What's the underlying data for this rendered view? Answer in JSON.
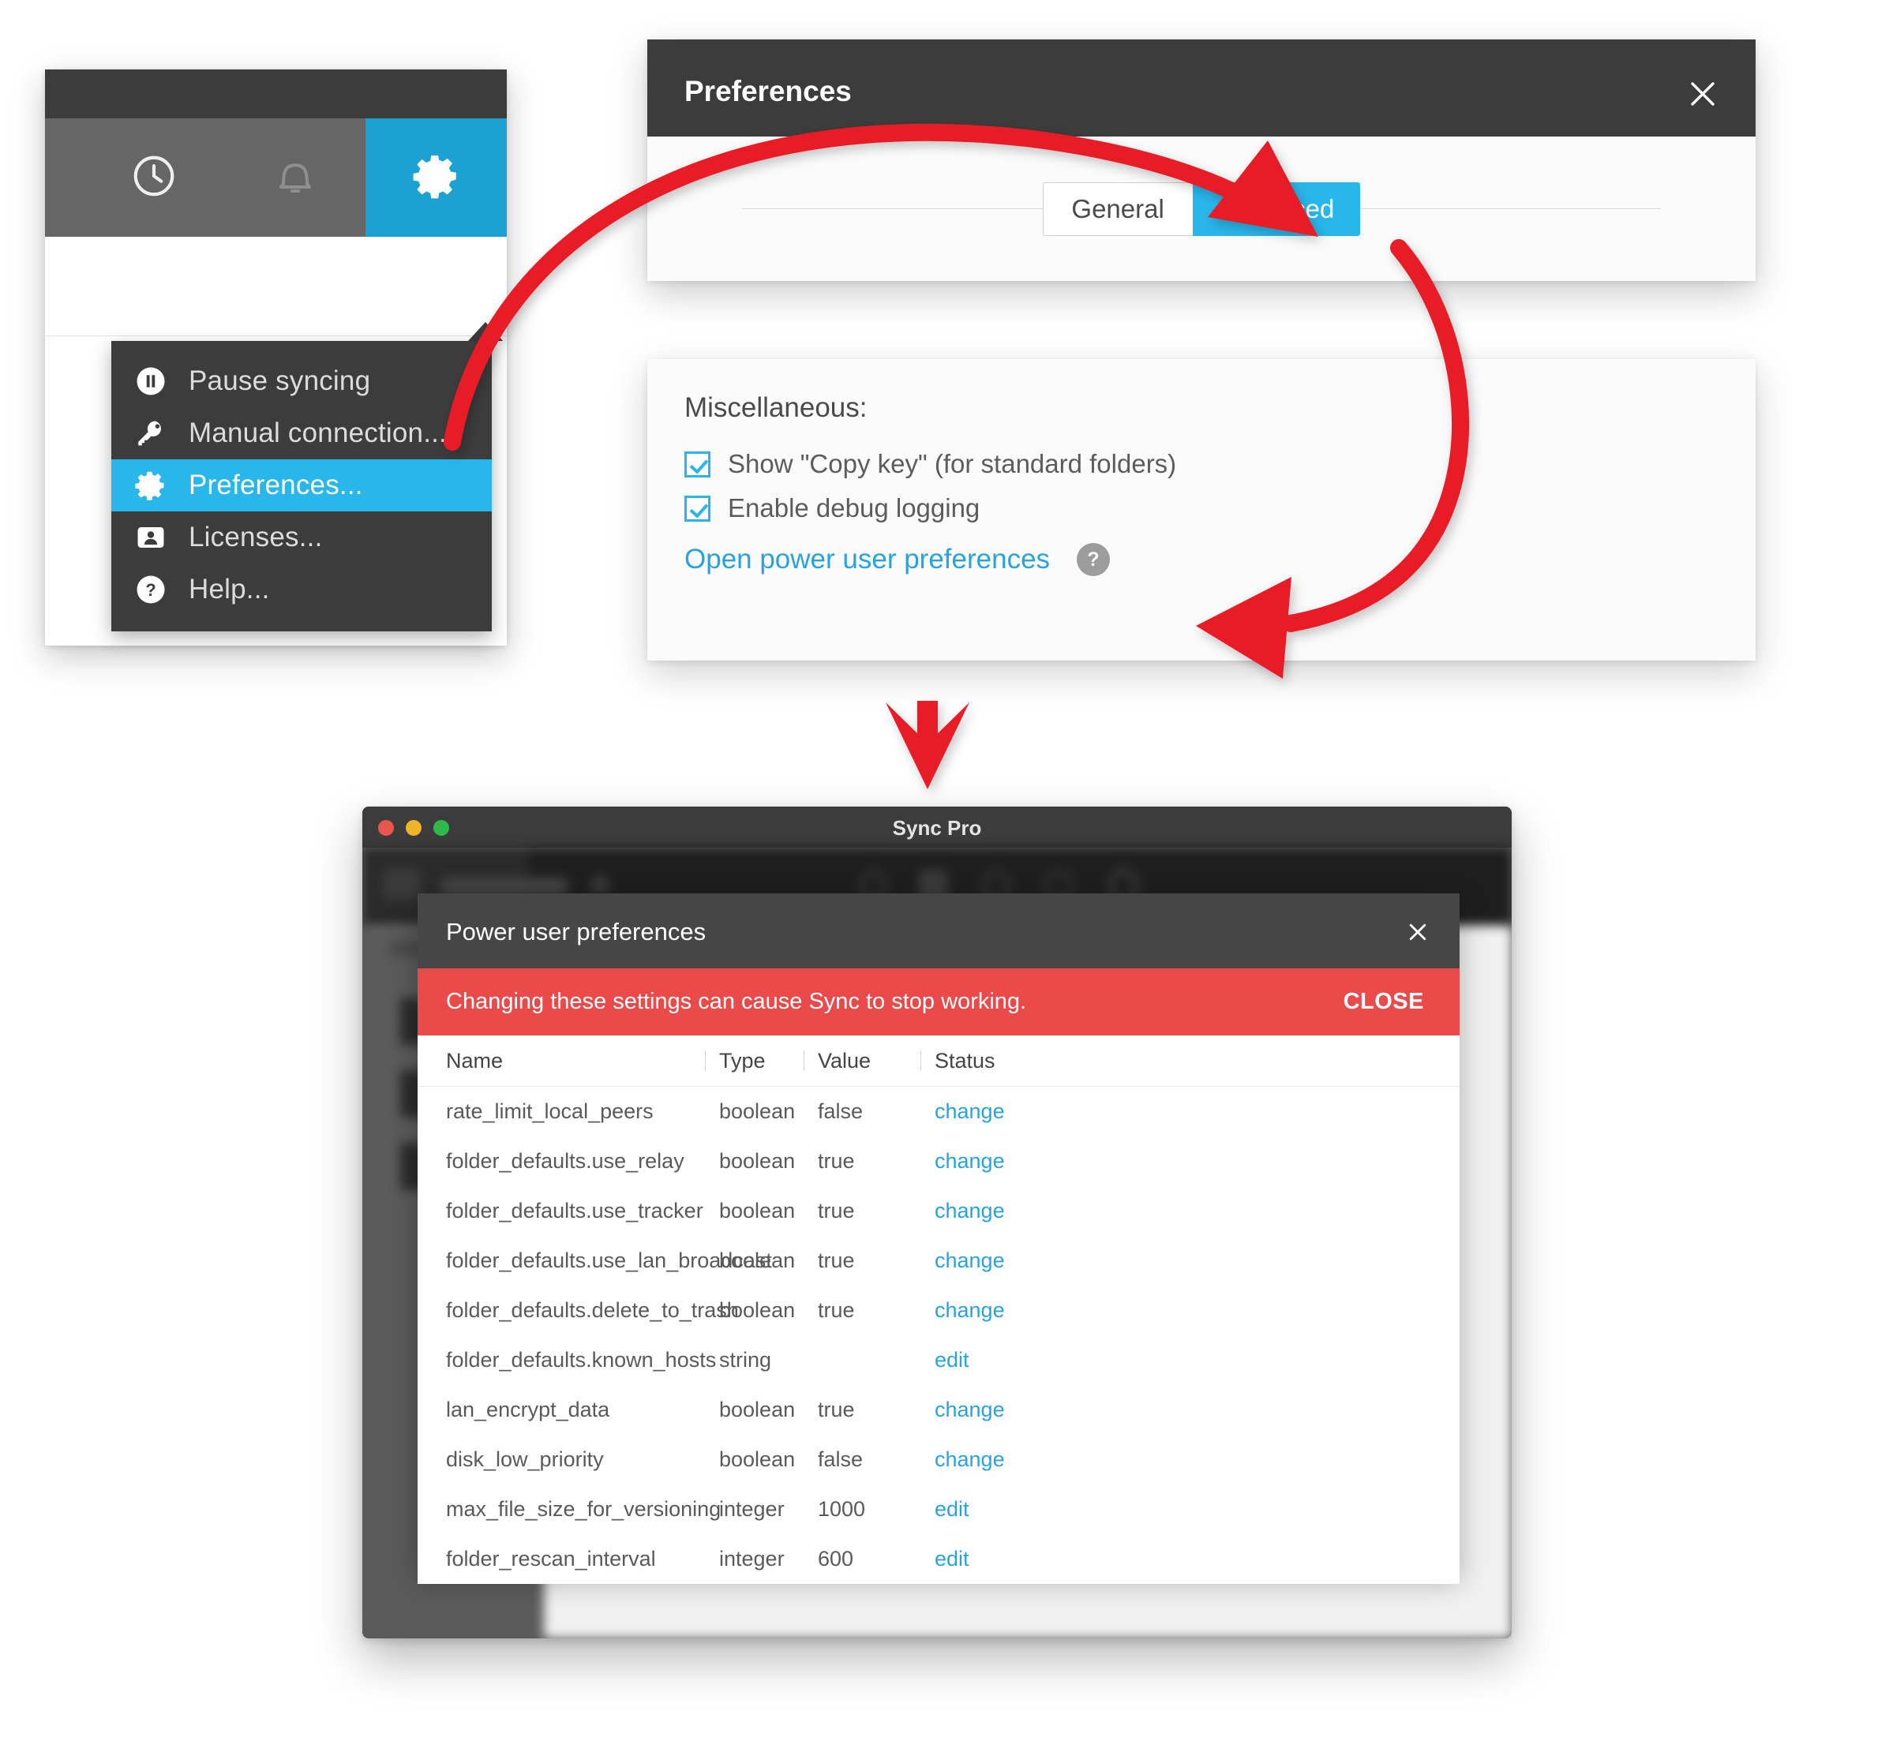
{
  "tray": {
    "toolbar_icons": [
      {
        "name": "history-icon",
        "glyph": "clock"
      },
      {
        "name": "notifications-icon",
        "glyph": "bell"
      },
      {
        "name": "settings-icon",
        "glyph": "gear"
      }
    ],
    "menu": {
      "items": [
        {
          "icon": "pause-icon",
          "label": "Pause syncing",
          "selected": false
        },
        {
          "icon": "key-icon",
          "label": "Manual connection...",
          "selected": false
        },
        {
          "icon": "gear-icon",
          "label": "Preferences...",
          "selected": true
        },
        {
          "icon": "license-icon",
          "label": "Licenses...",
          "selected": false
        },
        {
          "icon": "help-icon",
          "label": "Help...",
          "selected": false
        }
      ]
    }
  },
  "preferences": {
    "title": "Preferences",
    "close_glyph": "✕",
    "tabs": [
      {
        "label": "General",
        "active": false
      },
      {
        "label": "Advanced",
        "active": true
      }
    ]
  },
  "misc": {
    "heading": "Miscellaneous:",
    "checkboxes": [
      {
        "label": "Show \"Copy key\" (for standard folders)",
        "checked": true
      },
      {
        "label": "Enable debug logging",
        "checked": true
      }
    ],
    "link": "Open power user preferences",
    "help_glyph": "?"
  },
  "syncpro": {
    "window_title": "Sync Pro",
    "traffic_lights": [
      "close",
      "minimize",
      "zoom"
    ],
    "background_toolbar_label": "Add Folder"
  },
  "power_user": {
    "title": "Power user preferences",
    "close_glyph": "✕",
    "warning_text": "Changing these settings can cause Sync to stop working.",
    "warning_close_label": "CLOSE",
    "columns": [
      "Name",
      "Type",
      "Value",
      "Status"
    ],
    "rows": [
      {
        "name": "rate_limit_local_peers",
        "type": "boolean",
        "value": "false",
        "status": "change"
      },
      {
        "name": "folder_defaults.use_relay",
        "type": "boolean",
        "value": "true",
        "status": "change"
      },
      {
        "name": "folder_defaults.use_tracker",
        "type": "boolean",
        "value": "true",
        "status": "change"
      },
      {
        "name": "folder_defaults.use_lan_broadcast",
        "type": "boolean",
        "value": "true",
        "status": "change"
      },
      {
        "name": "folder_defaults.delete_to_trash",
        "type": "boolean",
        "value": "true",
        "status": "change"
      },
      {
        "name": "folder_defaults.known_hosts",
        "type": "string",
        "value": "",
        "status": "edit"
      },
      {
        "name": "lan_encrypt_data",
        "type": "boolean",
        "value": "true",
        "status": "change"
      },
      {
        "name": "disk_low_priority",
        "type": "boolean",
        "value": "false",
        "status": "change"
      },
      {
        "name": "max_file_size_for_versioning",
        "type": "integer",
        "value": "1000",
        "status": "edit"
      },
      {
        "name": "folder_rescan_interval",
        "type": "integer",
        "value": "600",
        "status": "edit"
      }
    ]
  },
  "annotations": {
    "arrow_color": "#e81d26",
    "arrows": [
      {
        "name": "arrow-preferences-to-advanced-tab"
      },
      {
        "name": "arrow-advanced-tab-to-power-user-link"
      },
      {
        "name": "arrow-down-to-sync-pro-window"
      }
    ]
  },
  "colors": {
    "accent": "#29b6ea",
    "dark_chrome": "#3c3c3c",
    "warning_red": "#ea4a4a",
    "link_blue": "#29a3e0"
  }
}
